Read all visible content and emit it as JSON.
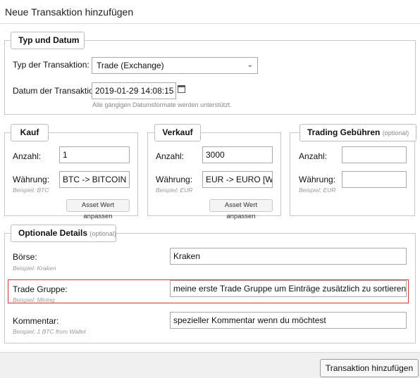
{
  "dialog": {
    "title": "Neue Transaktion hinzufügen"
  },
  "typ_datum": {
    "legend": "Typ und Datum",
    "type_label": "Typ der Transaktion:",
    "type_value": "Trade (Exchange)",
    "date_label": "Datum der Transaktion:",
    "date_value": "2019-01-29 14:08:15",
    "date_hint": "Alle gängigen Datumsformate werden unterstützt."
  },
  "kauf": {
    "legend": "Kauf",
    "amount_label": "Anzahl:",
    "amount_value": "1",
    "currency_label": "Währung:",
    "currency_value": "BTC -> BITCOIN [C",
    "example": "Beispiel: BTC",
    "adjust_button": "Asset Wert anpassen"
  },
  "verkauf": {
    "legend": "Verkauf",
    "amount_label": "Anzahl:",
    "amount_value": "3000",
    "currency_label": "Währung:",
    "currency_value": "EUR -> EURO [WÄ",
    "example": "Beispiel: EUR",
    "adjust_button": "Asset Wert anpassen"
  },
  "gebuehren": {
    "legend": "Trading Gebühren",
    "optional": "(optional)",
    "amount_label": "Anzahl:",
    "amount_value": "",
    "currency_label": "Währung:",
    "currency_value": "",
    "example": "Beispiel: EUR"
  },
  "details": {
    "legend": "Optionale Details",
    "optional": "(optional)",
    "boerse_label": "Börse:",
    "boerse_value": "Kraken",
    "boerse_example": "Beispiel: Kraken",
    "gruppe_label": "Trade Gruppe:",
    "gruppe_value": "meine erste Trade Gruppe um Einträge zusätzlich zu sortieren",
    "gruppe_example": "Beispiel: Mining",
    "kommentar_label": "Kommentar:",
    "kommentar_value": "spezieller Kommentar wenn du möchtest",
    "kommentar_example": "Beispiel: 1 BTC from Wallet"
  },
  "footer": {
    "submit_label": "Transaktion hinzufügen"
  },
  "colors": {
    "highlight": "#d23a3a",
    "border": "#c9c9c9"
  }
}
